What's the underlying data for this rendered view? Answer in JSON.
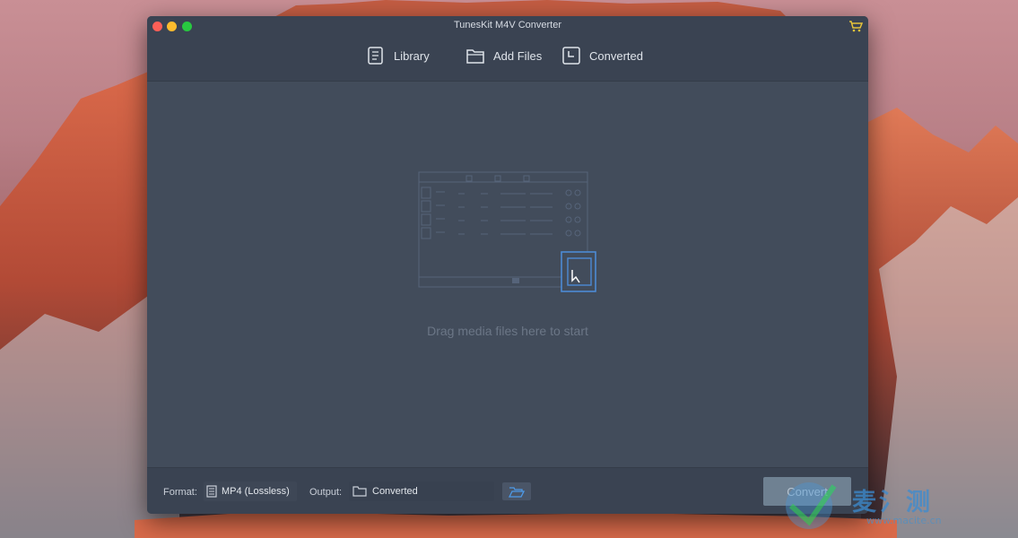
{
  "window": {
    "title": "TunesKit M4V Converter"
  },
  "toolbar": {
    "library_label": "Library",
    "add_files_label": "Add Files",
    "converted_label": "Converted"
  },
  "content": {
    "drag_hint": "Drag media files here to start"
  },
  "bottombar": {
    "format_label": "Format:",
    "format_value": "MP4 (Lossless)",
    "output_label": "Output:",
    "output_value": "Converted",
    "convert_label": "Convert"
  },
  "watermark": {
    "text_cn": "麦氵测",
    "site": "www.macite.cn"
  },
  "colors": {
    "window_bg": "#3f4857",
    "toolbar_bg": "#3a4352",
    "content_bg": "#424c5b",
    "close": "#fc5f57",
    "minimize": "#fdbc2e",
    "maximize": "#28c840",
    "cart": "#e5c33a",
    "convert_button": "#6f8192"
  },
  "icons": {
    "library": "library-icon",
    "add_files": "folder-icon",
    "converted": "history-icon",
    "cart": "cart-icon",
    "format": "film-icon",
    "output": "folder-icon",
    "browse": "open-folder-icon"
  }
}
